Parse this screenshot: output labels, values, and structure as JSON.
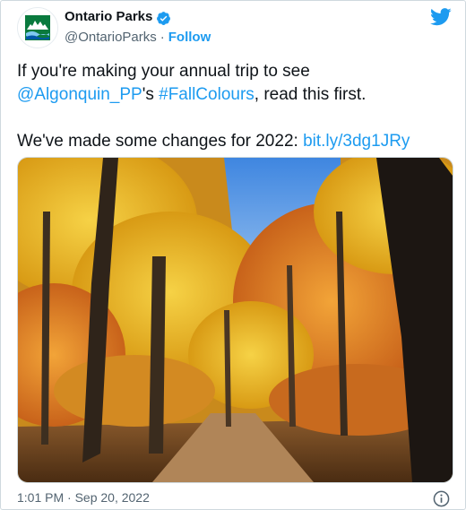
{
  "author": {
    "name": "Ontario Parks",
    "handle": "@OntarioParks",
    "separator": "·",
    "follow_label": "Follow",
    "avatar_icon": "ontario-parks-logo",
    "verified_icon": "verified-badge-icon"
  },
  "brand_icon": "twitter-bird-icon",
  "tweet": {
    "line1_text": "If you're making your annual trip to see",
    "mention": "@Algonquin_PP",
    "possessive": "'s ",
    "hashtag": "#FallColours",
    "line2_tail": ", read this first.",
    "line3_text": "We've made some changes for 2022: ",
    "url": "bit.ly/3dg1JRy"
  },
  "media": {
    "photo_icon": "autumn-forest-trail-photo"
  },
  "footer": {
    "timestamp": "1:01 PM · Sep 20, 2022",
    "info_icon": "info-icon"
  },
  "colors": {
    "accent": "#1d9bf0",
    "text": "#0f1419",
    "muted": "#536471",
    "verified": "#1d9bf0",
    "brand_green": "#0a7a3e"
  }
}
